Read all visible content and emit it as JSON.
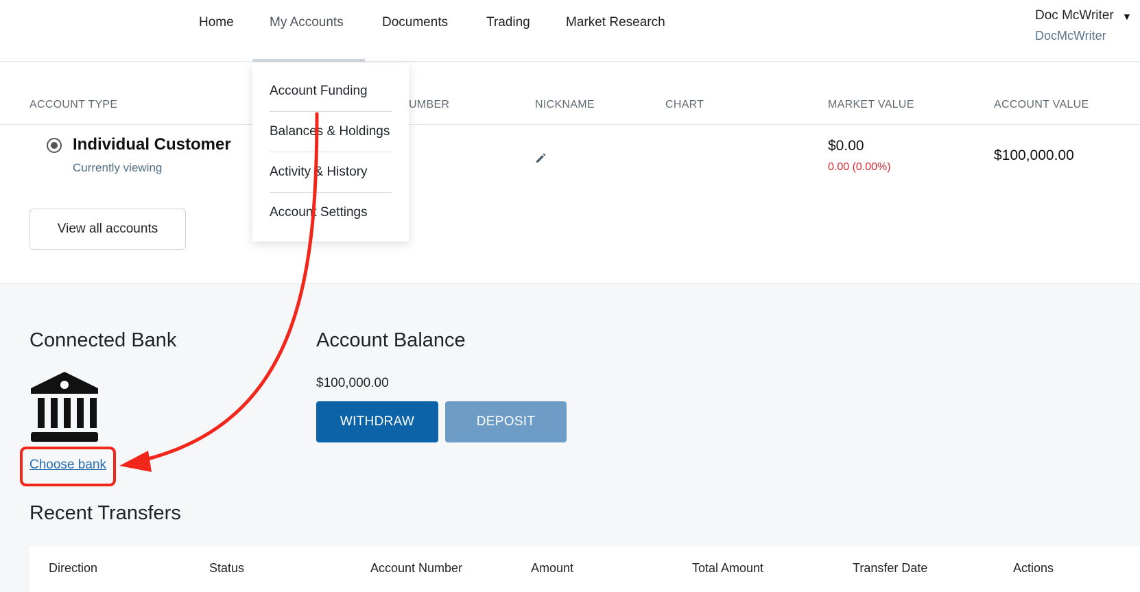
{
  "nav": {
    "items": [
      "Home",
      "My Accounts",
      "Documents",
      "Trading",
      "Market Research"
    ],
    "user_name": "Doc McWriter",
    "user_handle": "DocMcWriter"
  },
  "dropdown": {
    "items": [
      "Account Funding",
      "Balances & Holdings",
      "Activity & History",
      "Account Settings"
    ]
  },
  "accounts_table": {
    "headers": [
      "ACCOUNT TYPE",
      "UMBER",
      "NICKNAME",
      "CHART",
      "MARKET VALUE",
      "ACCOUNT VALUE"
    ],
    "row": {
      "account_type": "Individual Customer",
      "status": "Currently viewing",
      "market_value": "$0.00",
      "market_change": "0.00 (0.00%)",
      "account_value": "$100,000.00"
    },
    "view_all_label": "View all accounts"
  },
  "connected_bank": {
    "title": "Connected Bank",
    "icon": "bank-icon",
    "link_label": "Choose bank"
  },
  "account_balance": {
    "title": "Account Balance",
    "amount": "$100,000.00",
    "withdraw_label": "WITHDRAW",
    "deposit_label": "DEPOSIT"
  },
  "recent_transfers": {
    "title": "Recent Transfers",
    "headers": [
      "Direction",
      "Status",
      "Account Number",
      "Amount",
      "Total Amount",
      "Transfer Date",
      "Actions"
    ]
  },
  "colors": {
    "primary": "#0c63a8",
    "primary_disabled": "#6d9dc7",
    "negative": "#d9262f",
    "annotation": "#f2271c",
    "link": "#2a6cb0"
  }
}
